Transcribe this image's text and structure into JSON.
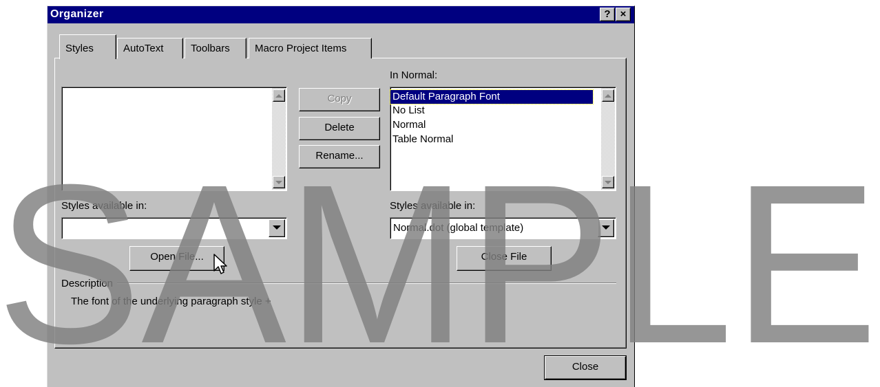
{
  "window": {
    "title": "Organizer",
    "help_label": "?",
    "close_label": "×"
  },
  "tabs": [
    {
      "label": "Styles",
      "active": true
    },
    {
      "label": "AutoText"
    },
    {
      "label": "Toolbars"
    },
    {
      "label": "Macro Project Items"
    }
  ],
  "left_list": {
    "header": "",
    "items": []
  },
  "right_list": {
    "header": "In Normal:",
    "items": [
      "Default Paragraph Font",
      "No List",
      "Normal",
      "Table Normal"
    ],
    "selected": "Default Paragraph Font"
  },
  "buttons": {
    "copy": "Copy",
    "delete": "Delete",
    "rename": "Rename...",
    "open_file": "Open File...",
    "close_file": "Close File",
    "close": "Close"
  },
  "left_available": {
    "label": "Styles available in:",
    "value": ""
  },
  "right_available": {
    "label": "Styles available in:",
    "value": "Normal.dot (global template)"
  },
  "description": {
    "label": "Description",
    "text": "The font of the underlying paragraph style +"
  },
  "watermark": {
    "text": "SAMPLE"
  }
}
